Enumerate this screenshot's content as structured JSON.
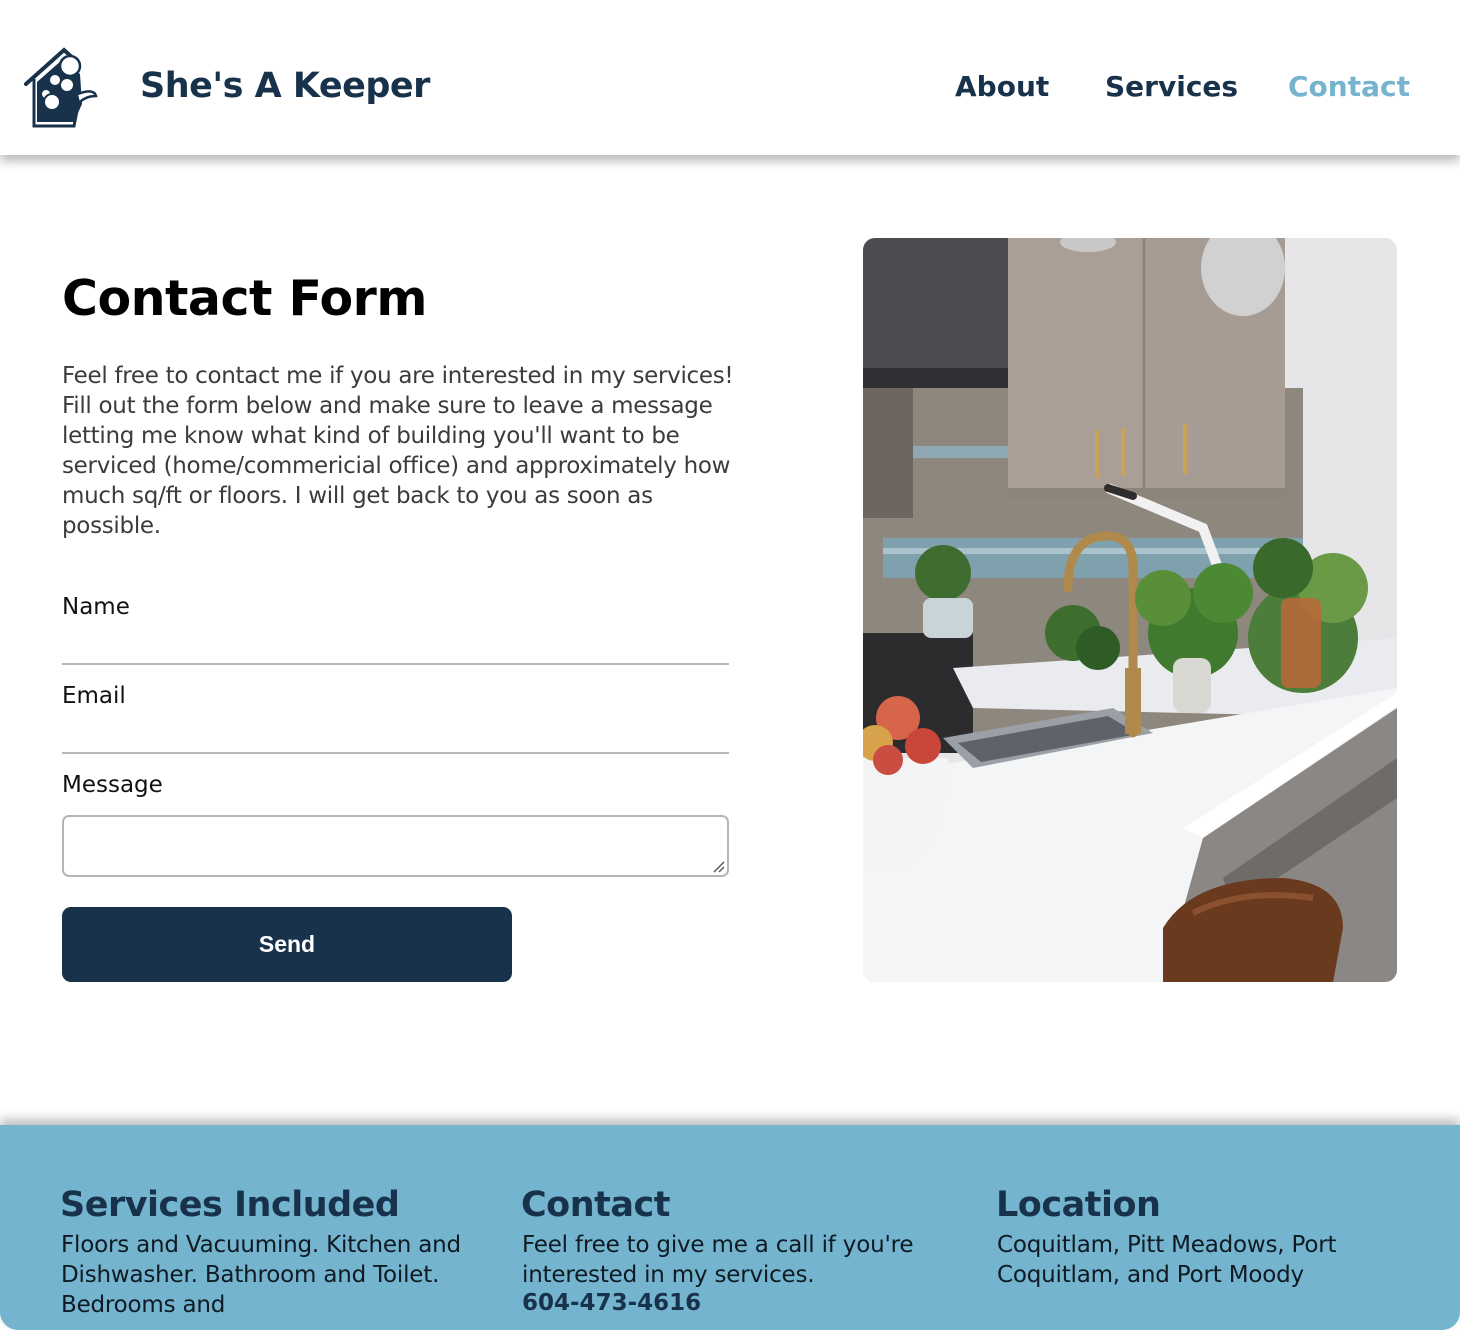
{
  "header": {
    "brand": "She's A Keeper",
    "nav": {
      "about": "About",
      "services": "Services",
      "contact": "Contact"
    },
    "active_nav": "Contact"
  },
  "main": {
    "title": "Contact Form",
    "intro": "Feel free to contact me if you are interested in my services! Fill out the form below and make sure to leave a message letting me know what kind of building you'll want to be serviced (home/commericial office) and approximately how much sq/ft or floors. I will get back to you as soon as possible.",
    "form": {
      "name_label": "Name",
      "name_value": "",
      "email_label": "Email",
      "email_value": "",
      "message_label": "Message",
      "message_value": "",
      "send_label": "Send"
    }
  },
  "footer": {
    "services": {
      "heading": "Services Included",
      "text": "Floors and Vacuuming. Kitchen and Dishwasher. Bathroom and Toilet. Bedrooms and"
    },
    "contact": {
      "heading": "Contact",
      "text": "Feel free to give me a call if you're interested in my services.",
      "phone": "604-473-4616"
    },
    "location": {
      "heading": "Location",
      "text": "Coquitlam, Pitt Meadows, Port Coquitlam, and Port Moody"
    }
  },
  "colors": {
    "navy": "#18324b",
    "accent": "#75b3cf",
    "footer_bg": "#74b4cf"
  },
  "icons": {
    "logo": "house-with-bubbles-logo",
    "resize": "resize-grip-icon"
  }
}
